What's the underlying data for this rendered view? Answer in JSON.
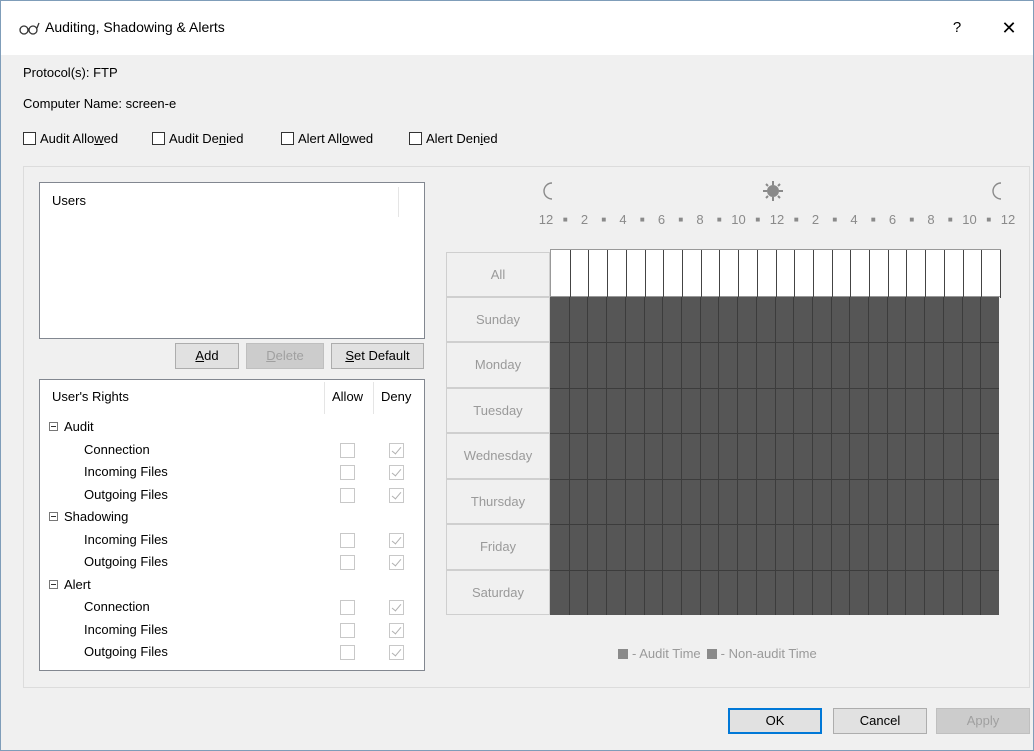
{
  "window": {
    "title": "Auditing, Shadowing & Alerts",
    "help_label": "?",
    "close_label": "✕"
  },
  "info": {
    "protocols": "Protocol(s): FTP",
    "computer_name": "Computer Name: screen-e"
  },
  "top_checkboxes": [
    {
      "pre": "Audit Allo",
      "u": "w",
      "post": "ed"
    },
    {
      "pre": "Audit De",
      "u": "n",
      "post": "ied"
    },
    {
      "pre": "Alert All",
      "u": "o",
      "post": "wed"
    },
    {
      "pre": "Alert Den",
      "u": "i",
      "post": "ed"
    }
  ],
  "users": {
    "header": "Users",
    "buttons": {
      "add_u": "A",
      "add_rest": "dd",
      "delete_u": "D",
      "delete_rest": "elete",
      "setdefault_u": "S",
      "setdefault_rest": "et Default"
    }
  },
  "rights": {
    "col_name": "User's Rights",
    "col_allow": "Allow",
    "col_deny": "Deny",
    "groups": [
      {
        "label": "Audit",
        "items": [
          {
            "label": "Connection",
            "allow": false,
            "deny": true
          },
          {
            "label": "Incoming Files",
            "allow": false,
            "deny": true
          },
          {
            "label": "Outgoing Files",
            "allow": false,
            "deny": true
          }
        ]
      },
      {
        "label": "Shadowing",
        "items": [
          {
            "label": "Incoming Files",
            "allow": false,
            "deny": true
          },
          {
            "label": "Outgoing Files",
            "allow": false,
            "deny": true
          }
        ]
      },
      {
        "label": "Alert",
        "items": [
          {
            "label": "Connection",
            "allow": false,
            "deny": true
          },
          {
            "label": "Incoming Files",
            "allow": false,
            "deny": true
          },
          {
            "label": "Outgoing Files",
            "allow": false,
            "deny": true
          }
        ]
      }
    ]
  },
  "schedule": {
    "icons": [
      "moon-icon",
      "sun-icon",
      "moon-icon"
    ],
    "hour_labels": [
      "12",
      "■",
      "2",
      "■",
      "4",
      "■",
      "6",
      "■",
      "8",
      "■",
      "10",
      "■",
      "12",
      "■",
      "2",
      "■",
      "4",
      "■",
      "6",
      "■",
      "8",
      "■",
      "10",
      "■",
      "12"
    ],
    "all_label": "All",
    "days": [
      "Sunday",
      "Monday",
      "Tuesday",
      "Wednesday",
      "Thursday",
      "Friday",
      "Saturday"
    ],
    "hour_columns": 24,
    "audit_color": "#565656",
    "legend_audit": "- Audit Time",
    "legend_nonaudit": "- Non-audit Time"
  },
  "footer": {
    "ok": "OK",
    "cancel": "Cancel",
    "apply": "Apply"
  }
}
